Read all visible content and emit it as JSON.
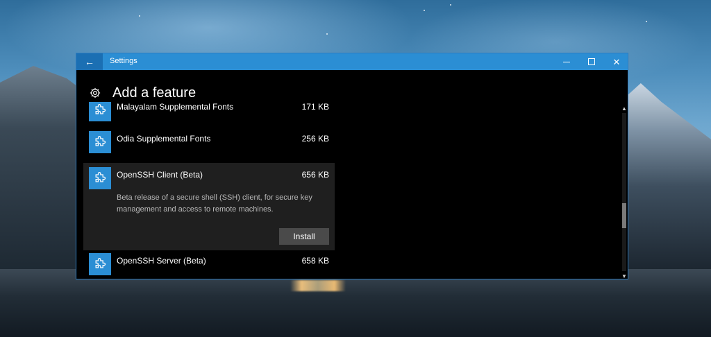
{
  "window": {
    "title": "Settings",
    "back_label": "←",
    "close_label": "✕"
  },
  "page": {
    "title": "Add a feature"
  },
  "features": [
    {
      "name": "Malayalam Supplemental Fonts",
      "size": "171 KB",
      "icon": "puzzle-icon",
      "expanded": false
    },
    {
      "name": "Odia Supplemental Fonts",
      "size": "256 KB",
      "icon": "puzzle-icon",
      "expanded": false
    },
    {
      "name": "OpenSSH Client (Beta)",
      "size": "656 KB",
      "icon": "puzzle-icon",
      "expanded": true,
      "description": "Beta release of a secure shell (SSH) client, for secure key management and access to remote machines.",
      "action": "Install"
    },
    {
      "name": "OpenSSH Server (Beta)",
      "size": "658 KB",
      "icon": "puzzle-icon",
      "expanded": false
    }
  ],
  "colors": {
    "accent": "#2b8ed4",
    "window_bg": "#000000",
    "expanded_bg": "#1f1f1f",
    "button_bg": "#4a4a4a"
  }
}
